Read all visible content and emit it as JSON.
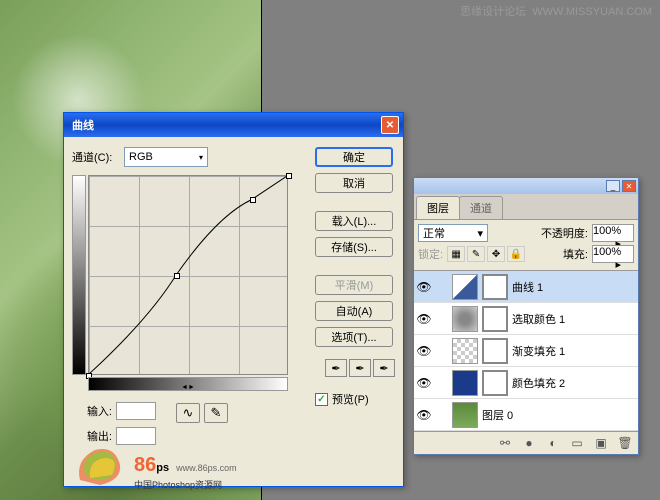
{
  "watermark": {
    "text": "思缘设计论坛",
    "url": "WWW.MISSYUAN.COM"
  },
  "curves_dialog": {
    "title": "曲线",
    "channel_label": "通道(C):",
    "channel_value": "RGB",
    "input_label": "输入:",
    "output_label": "输出:",
    "buttons": {
      "ok": "确定",
      "cancel": "取消",
      "load": "载入(L)...",
      "save": "存储(S)...",
      "smooth": "平滑(M)",
      "auto": "自动(A)",
      "options": "选项(T)..."
    },
    "preview_label": "预览(P)",
    "preview_checked": true
  },
  "layers_panel": {
    "tabs": {
      "layers": "图层",
      "channels": "通道"
    },
    "blend_mode": "正常",
    "opacity_label": "不透明度:",
    "opacity_value": "100%",
    "lock_label": "锁定:",
    "fill_label": "填充:",
    "fill_value": "100%",
    "layers": [
      {
        "name": "曲线 1",
        "type": "curves",
        "visible": true,
        "selected": true
      },
      {
        "name": "选取颜色 1",
        "type": "selcolor",
        "visible": true,
        "selected": false
      },
      {
        "name": "渐变填充 1",
        "type": "gradient",
        "visible": true,
        "selected": false
      },
      {
        "name": "颜色填充 2",
        "type": "solidcolor",
        "visible": true,
        "selected": false
      },
      {
        "name": "图层 0",
        "type": "image",
        "visible": true,
        "selected": false
      }
    ]
  },
  "logo": {
    "brand": "86",
    "suffix": "ps",
    "url": "www.86ps.com",
    "tagline": "中国Photoshop资源网"
  },
  "chart_data": {
    "type": "line",
    "title": "曲线 (Curves adjustment)",
    "xlabel": "输入 (Input)",
    "ylabel": "输出 (Output)",
    "xlim": [
      0,
      255
    ],
    "ylim": [
      0,
      255
    ],
    "points": [
      {
        "x": 0,
        "y": 0
      },
      {
        "x": 113,
        "y": 127
      },
      {
        "x": 209,
        "y": 224
      },
      {
        "x": 255,
        "y": 255
      }
    ]
  }
}
